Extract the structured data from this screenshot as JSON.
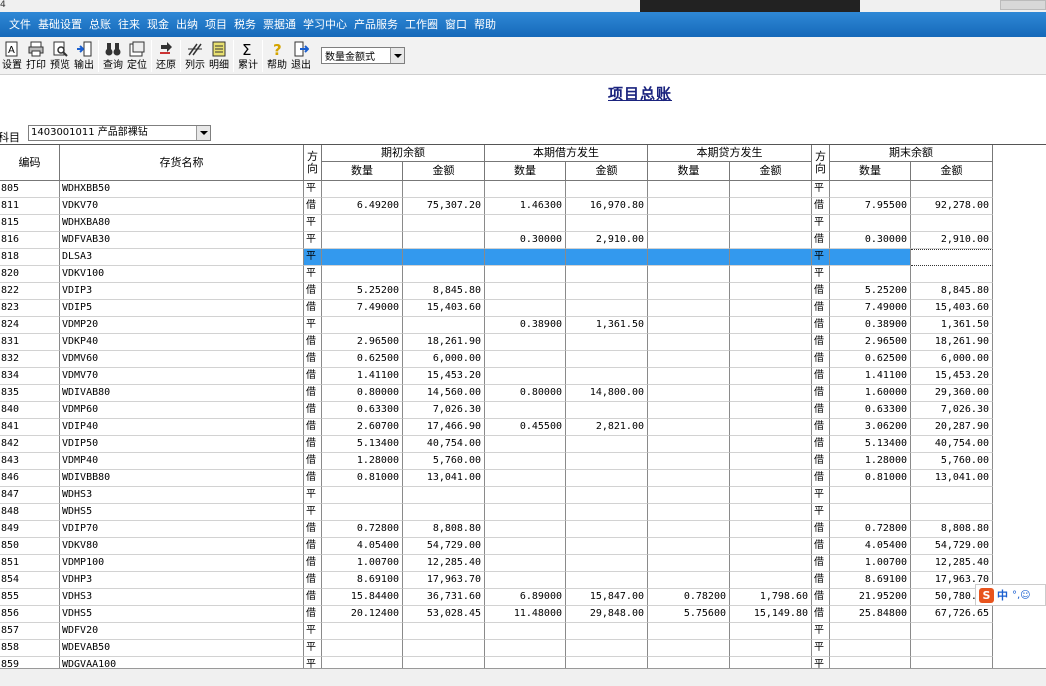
{
  "window": {
    "app_icon_text": "4"
  },
  "menu": [
    "文件",
    "基础设置",
    "总账",
    "往来",
    "现金",
    "出纳",
    "项目",
    "税务",
    "票据通",
    "学习中心",
    "产品服务",
    "工作圈",
    "窗口",
    "帮助"
  ],
  "toolbar": [
    {
      "icon": "settings-icon",
      "label": "设置"
    },
    {
      "icon": "print-icon",
      "label": "打印"
    },
    {
      "icon": "preview-icon",
      "label": "预览"
    },
    {
      "icon": "export-icon",
      "label": "输出"
    },
    {
      "sep": true
    },
    {
      "icon": "binoculars-icon",
      "label": "查询"
    },
    {
      "icon": "locate-icon",
      "label": "定位"
    },
    {
      "sep": true
    },
    {
      "icon": "restore-icon",
      "label": "还原"
    },
    {
      "sep": true
    },
    {
      "icon": "columns-icon",
      "label": "列示"
    },
    {
      "icon": "detail-icon",
      "label": "明细"
    },
    {
      "sep": true
    },
    {
      "icon": "sigma-icon",
      "label": "累计"
    },
    {
      "sep": true
    },
    {
      "icon": "help-icon",
      "label": "帮助"
    },
    {
      "icon": "exit-icon",
      "label": "退出"
    }
  ],
  "format_select": {
    "value": "数量金额式"
  },
  "page_title": "项目总账",
  "subject": {
    "label": "科目",
    "value": "1403001011 产品部裸钻"
  },
  "headers": {
    "code": "编码",
    "name": "存货名称",
    "direction": "方向",
    "opening": "期初余额",
    "debit": "本期借方发生",
    "credit": "本期贷方发生",
    "closing": "期末余额",
    "qty": "数量",
    "amount": "金额"
  },
  "rows": [
    [
      "805",
      "WDHXBB50",
      "平",
      "",
      "",
      "",
      "",
      "",
      "",
      "平",
      "",
      ""
    ],
    [
      "811",
      "VDKV70",
      "借",
      "6.49200",
      "75,307.20",
      "1.46300",
      "16,970.80",
      "",
      "",
      "借",
      "7.95500",
      "92,278.00"
    ],
    [
      "815",
      "WDHXBA80",
      "平",
      "",
      "",
      "",
      "",
      "",
      "",
      "平",
      "",
      ""
    ],
    [
      "816",
      "WDFVAB30",
      "平",
      "",
      "",
      "0.30000",
      "2,910.00",
      "",
      "",
      "借",
      "0.30000",
      "2,910.00"
    ],
    [
      "818",
      "DLSA3",
      "平",
      "",
      "",
      "",
      "",
      "",
      "",
      "平",
      "",
      ""
    ],
    [
      "820",
      "VDKV100",
      "平",
      "",
      "",
      "",
      "",
      "",
      "",
      "平",
      "",
      ""
    ],
    [
      "822",
      "VDIP3",
      "借",
      "5.25200",
      "8,845.80",
      "",
      "",
      "",
      "",
      "借",
      "5.25200",
      "8,845.80"
    ],
    [
      "823",
      "VDIP5",
      "借",
      "7.49000",
      "15,403.60",
      "",
      "",
      "",
      "",
      "借",
      "7.49000",
      "15,403.60"
    ],
    [
      "824",
      "VDMP20",
      "平",
      "",
      "",
      "0.38900",
      "1,361.50",
      "",
      "",
      "借",
      "0.38900",
      "1,361.50"
    ],
    [
      "831",
      "VDKP40",
      "借",
      "2.96500",
      "18,261.90",
      "",
      "",
      "",
      "",
      "借",
      "2.96500",
      "18,261.90"
    ],
    [
      "832",
      "VDMV60",
      "借",
      "0.62500",
      "6,000.00",
      "",
      "",
      "",
      "",
      "借",
      "0.62500",
      "6,000.00"
    ],
    [
      "834",
      "VDMV70",
      "借",
      "1.41100",
      "15,453.20",
      "",
      "",
      "",
      "",
      "借",
      "1.41100",
      "15,453.20"
    ],
    [
      "835",
      "WDIVAB80",
      "借",
      "0.80000",
      "14,560.00",
      "0.80000",
      "14,800.00",
      "",
      "",
      "借",
      "1.60000",
      "29,360.00"
    ],
    [
      "840",
      "VDMP60",
      "借",
      "0.63300",
      "7,026.30",
      "",
      "",
      "",
      "",
      "借",
      "0.63300",
      "7,026.30"
    ],
    [
      "841",
      "VDIP40",
      "借",
      "2.60700",
      "17,466.90",
      "0.45500",
      "2,821.00",
      "",
      "",
      "借",
      "3.06200",
      "20,287.90"
    ],
    [
      "842",
      "VDIP50",
      "借",
      "5.13400",
      "40,754.00",
      "",
      "",
      "",
      "",
      "借",
      "5.13400",
      "40,754.00"
    ],
    [
      "843",
      "VDMP40",
      "借",
      "1.28000",
      "5,760.00",
      "",
      "",
      "",
      "",
      "借",
      "1.28000",
      "5,760.00"
    ],
    [
      "846",
      "WDIVBB80",
      "借",
      "0.81000",
      "13,041.00",
      "",
      "",
      "",
      "",
      "借",
      "0.81000",
      "13,041.00"
    ],
    [
      "847",
      "WDHS3",
      "平",
      "",
      "",
      "",
      "",
      "",
      "",
      "平",
      "",
      ""
    ],
    [
      "848",
      "WDHS5",
      "平",
      "",
      "",
      "",
      "",
      "",
      "",
      "平",
      "",
      ""
    ],
    [
      "849",
      "VDIP70",
      "借",
      "0.72800",
      "8,808.80",
      "",
      "",
      "",
      "",
      "借",
      "0.72800",
      "8,808.80"
    ],
    [
      "850",
      "VDKV80",
      "借",
      "4.05400",
      "54,729.00",
      "",
      "",
      "",
      "",
      "借",
      "4.05400",
      "54,729.00"
    ],
    [
      "851",
      "VDMP100",
      "借",
      "1.00700",
      "12,285.40",
      "",
      "",
      "",
      "",
      "借",
      "1.00700",
      "12,285.40"
    ],
    [
      "854",
      "VDHP3",
      "借",
      "8.69100",
      "17,963.70",
      "",
      "",
      "",
      "",
      "借",
      "8.69100",
      "17,963.70"
    ],
    [
      "855",
      "VDHS3",
      "借",
      "15.84400",
      "36,731.60",
      "6.89000",
      "15,847.00",
      "0.78200",
      "1,798.60",
      "借",
      "21.95200",
      "50,780.00"
    ],
    [
      "856",
      "VDHS5",
      "借",
      "20.12400",
      "53,028.45",
      "11.48000",
      "29,848.00",
      "5.75600",
      "15,149.80",
      "借",
      "25.84800",
      "67,726.65"
    ],
    [
      "857",
      "WDFV20",
      "平",
      "",
      "",
      "",
      "",
      "",
      "",
      "平",
      "",
      ""
    ],
    [
      "858",
      "WDEVAB50",
      "平",
      "",
      "",
      "",
      "",
      "",
      "",
      "平",
      "",
      ""
    ],
    [
      "859",
      "WDGVAA100",
      "平",
      "",
      "",
      "",
      "",
      "",
      "",
      "平",
      "",
      ""
    ]
  ],
  "selected_row_index": 4,
  "ime": {
    "logo": "S",
    "mode": "中",
    "tail": "°,☺"
  }
}
